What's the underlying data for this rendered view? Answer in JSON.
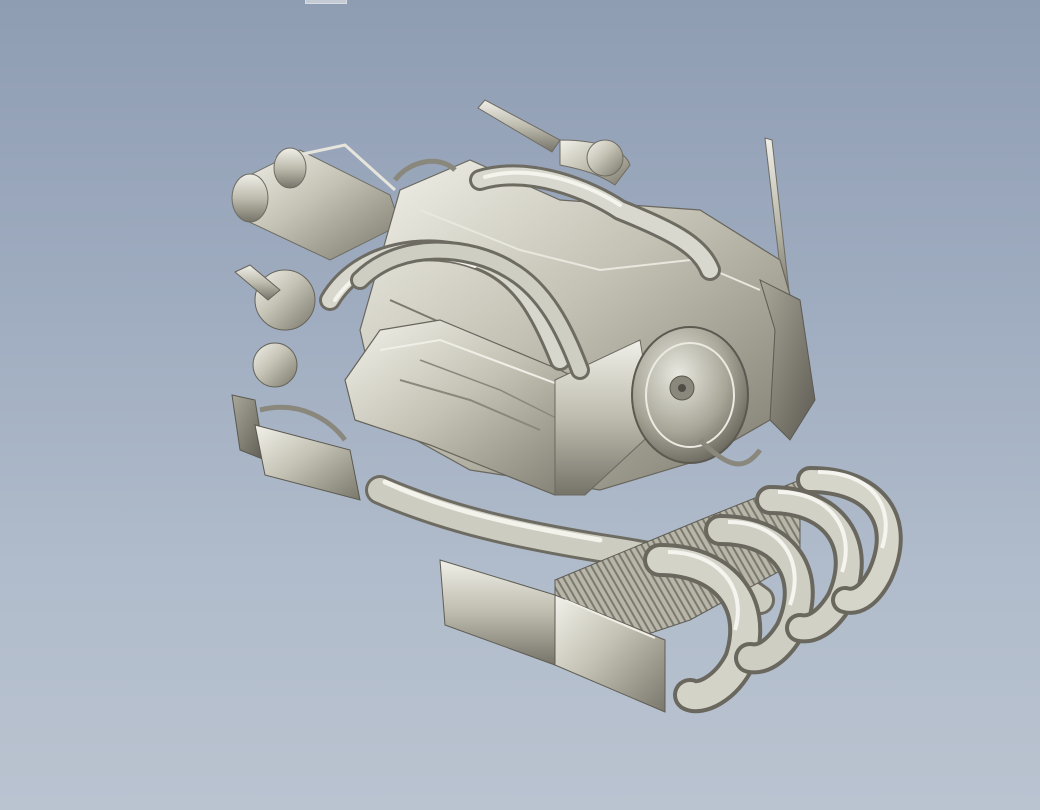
{
  "viewport": {
    "background_top": "#8f9db3",
    "background_bottom": "#bac3d0"
  },
  "model": {
    "icon": "engine-3d-model",
    "metal_light": "#efeee6",
    "metal_mid": "#b9b7a8",
    "metal_dark": "#6f6d62"
  }
}
